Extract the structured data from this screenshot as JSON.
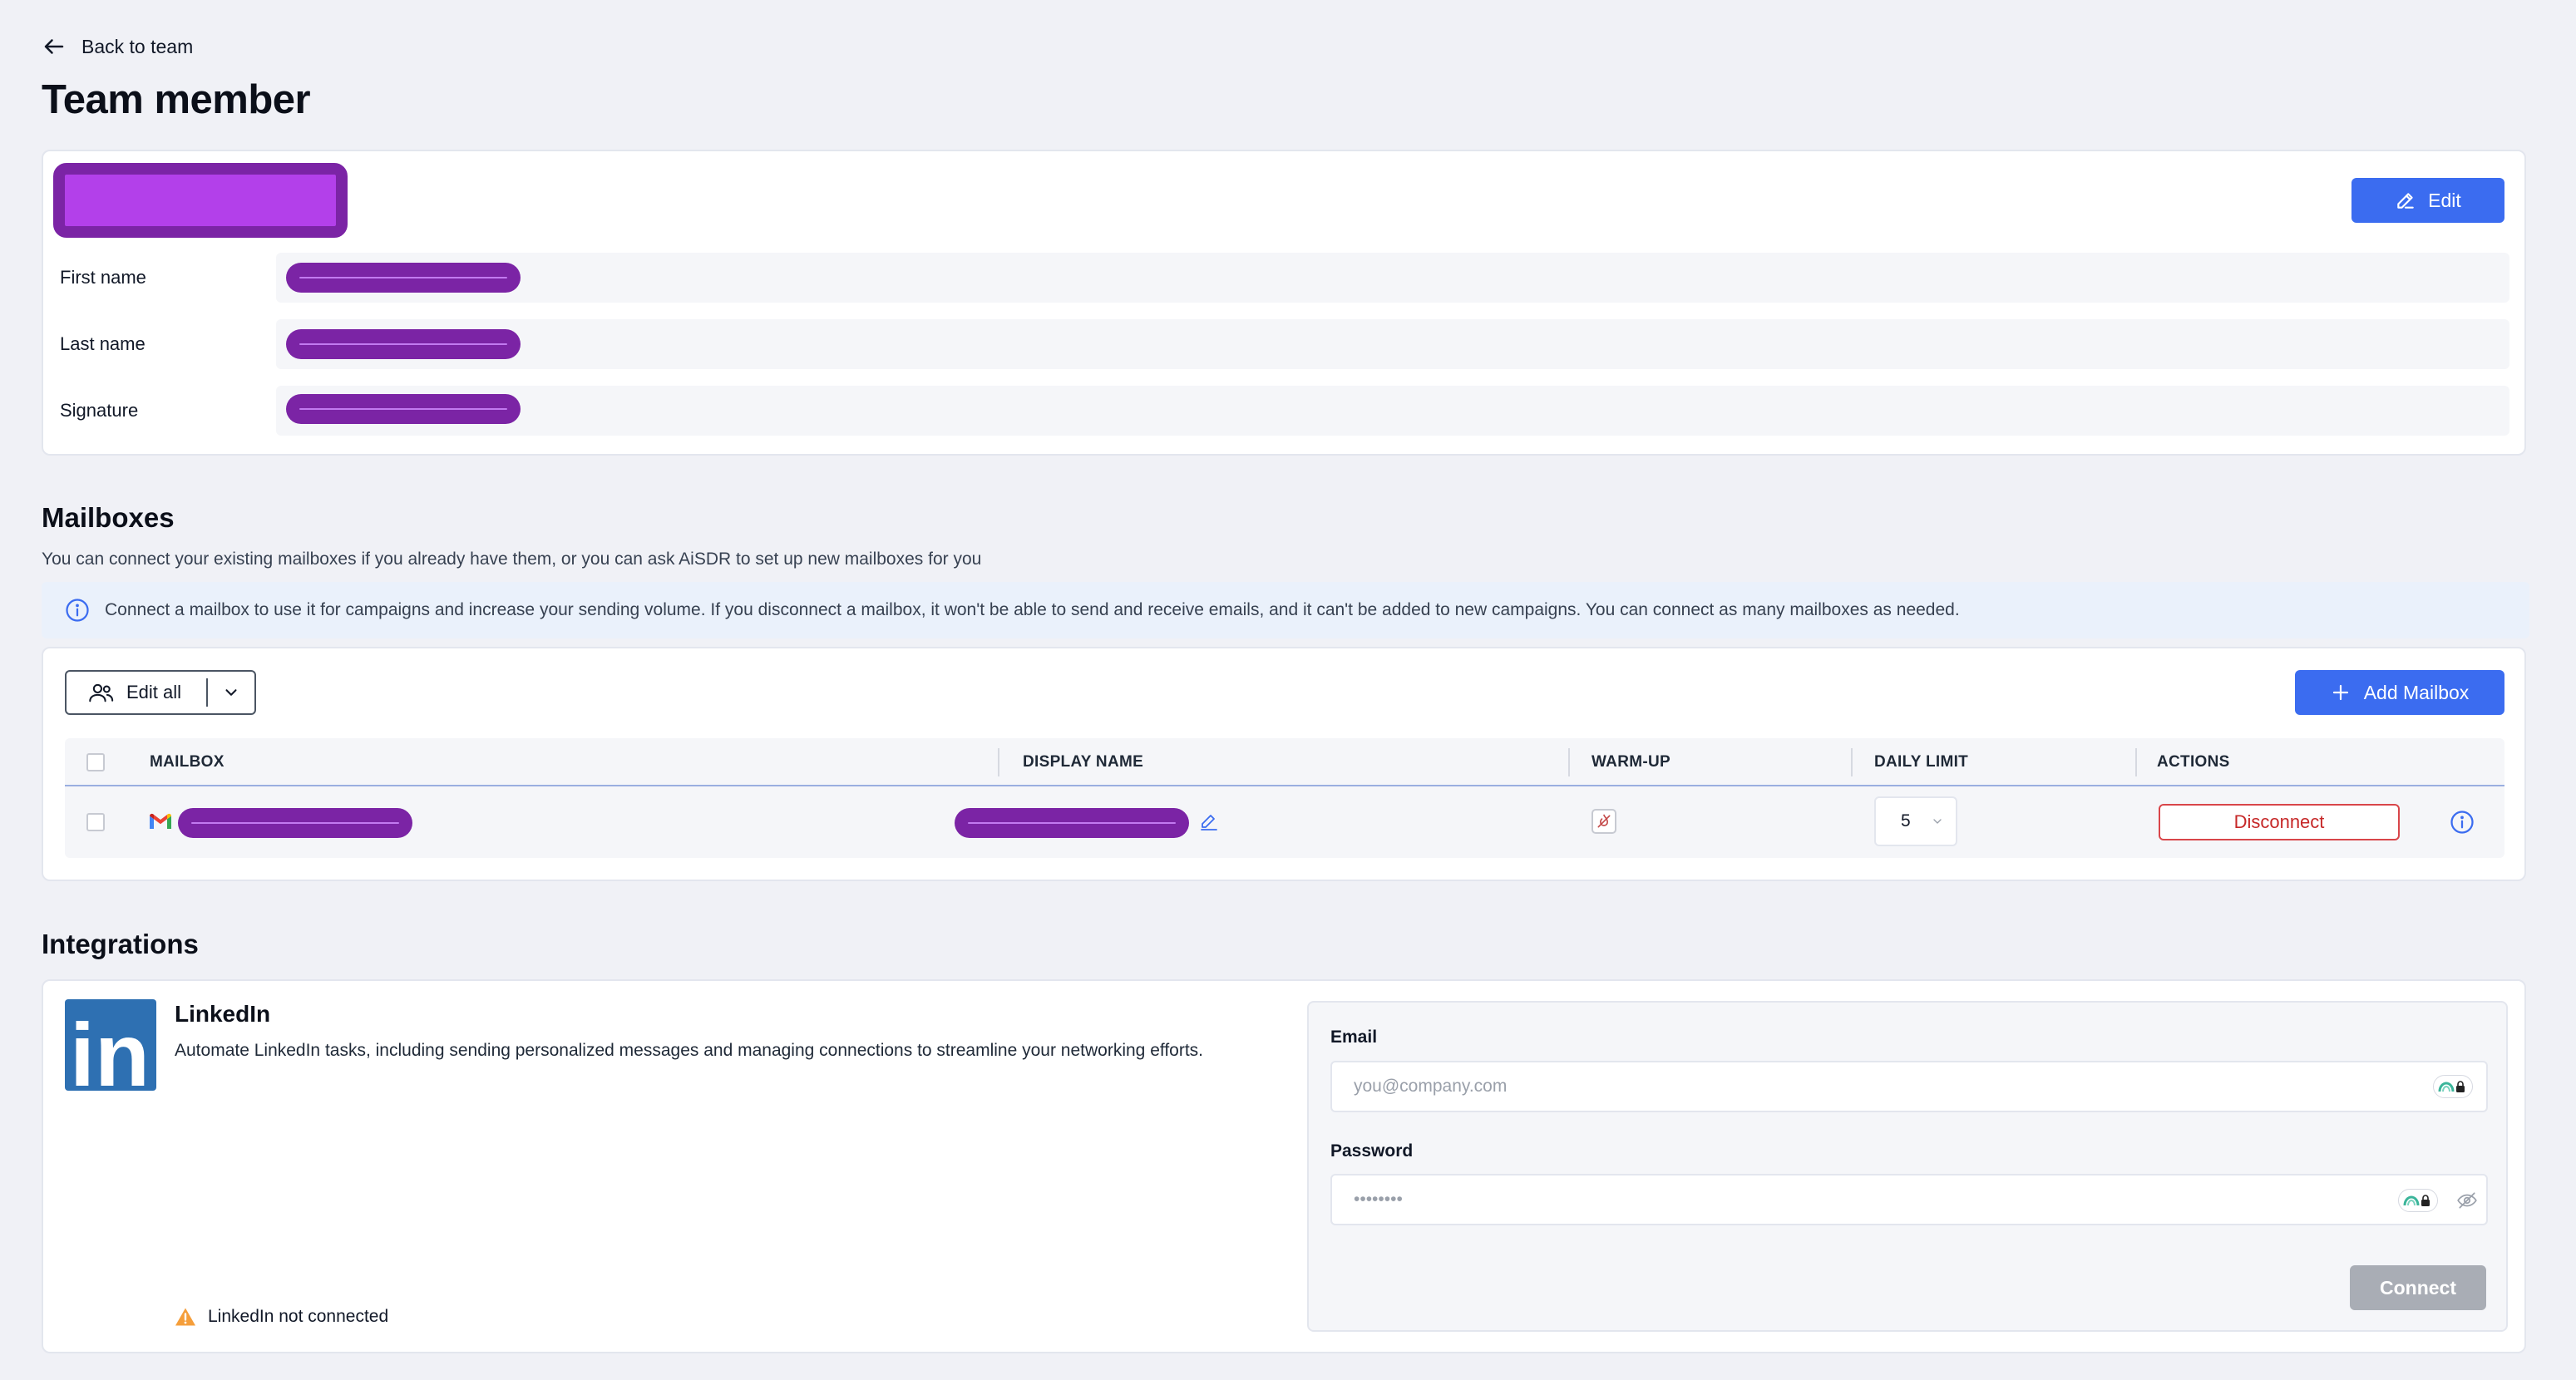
{
  "nav": {
    "back_label": "Back to team"
  },
  "page": {
    "title": "Team member"
  },
  "profile": {
    "edit_label": "Edit",
    "fields": [
      {
        "label": "First name"
      },
      {
        "label": "Last name"
      },
      {
        "label": "Signature"
      }
    ]
  },
  "mailboxes": {
    "title": "Mailboxes",
    "description": "You can connect your existing mailboxes if you already have them, or you can ask AiSDR to set up new mailboxes for you",
    "banner": "Connect a mailbox to use it for campaigns and increase your sending volume. If you disconnect a mailbox, it won't be able to send and receive emails, and it can't be added to new campaigns. You can connect as many mailboxes as needed.",
    "edit_all_label": "Edit all",
    "add_label": "Add Mailbox",
    "columns": [
      "MAILBOX",
      "DISPLAY NAME",
      "WARM-UP",
      "DAILY LIMIT",
      "ACTIONS"
    ],
    "rows": [
      {
        "daily_limit": "5",
        "action_label": "Disconnect"
      }
    ]
  },
  "integrations": {
    "title": "Integrations",
    "linkedin": {
      "logo_text": "in",
      "title": "LinkedIn",
      "description": "Automate LinkedIn tasks, including sending personalized messages and managing connections to streamline your networking efforts.",
      "status": "LinkedIn not connected",
      "email_label": "Email",
      "email_placeholder": "you@company.com",
      "password_label": "Password",
      "password_placeholder": "••••••••",
      "connect_label": "Connect"
    }
  },
  "colors": {
    "primary": "#3b6cf0",
    "danger": "#d9464a",
    "linkedin": "#2e70b2",
    "redaction": "#7b24a5",
    "disabled": "#a9adb5"
  }
}
